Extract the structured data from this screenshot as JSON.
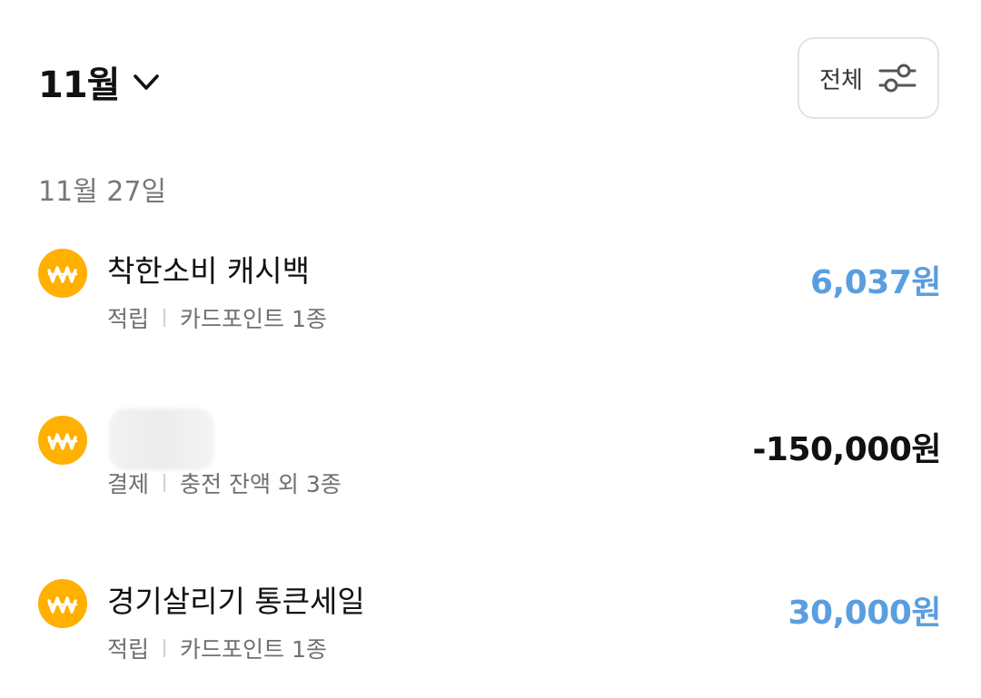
{
  "header": {
    "month_label": "11월",
    "filter_label": "전체"
  },
  "date_group": {
    "date_label": "11월 27일"
  },
  "transactions": [
    {
      "icon": "won-coin-icon",
      "title": "착한소비 캐시백",
      "type": "적립",
      "detail": "카드포인트 1종",
      "amount": "6,037원",
      "direction": "positive"
    },
    {
      "icon": "won-coin-icon",
      "title": "",
      "type": "결제",
      "detail": "충전 잔액 외 3종",
      "amount": "-150,000원",
      "direction": "negative"
    },
    {
      "icon": "won-coin-icon",
      "title": "경기살리기 통큰세일",
      "type": "적립",
      "detail": "카드포인트 1종",
      "amount": "30,000원",
      "direction": "positive"
    }
  ],
  "colors": {
    "positive_amount": "#5a9ee0",
    "negative_amount": "#111111",
    "coin": "#ffb000"
  }
}
